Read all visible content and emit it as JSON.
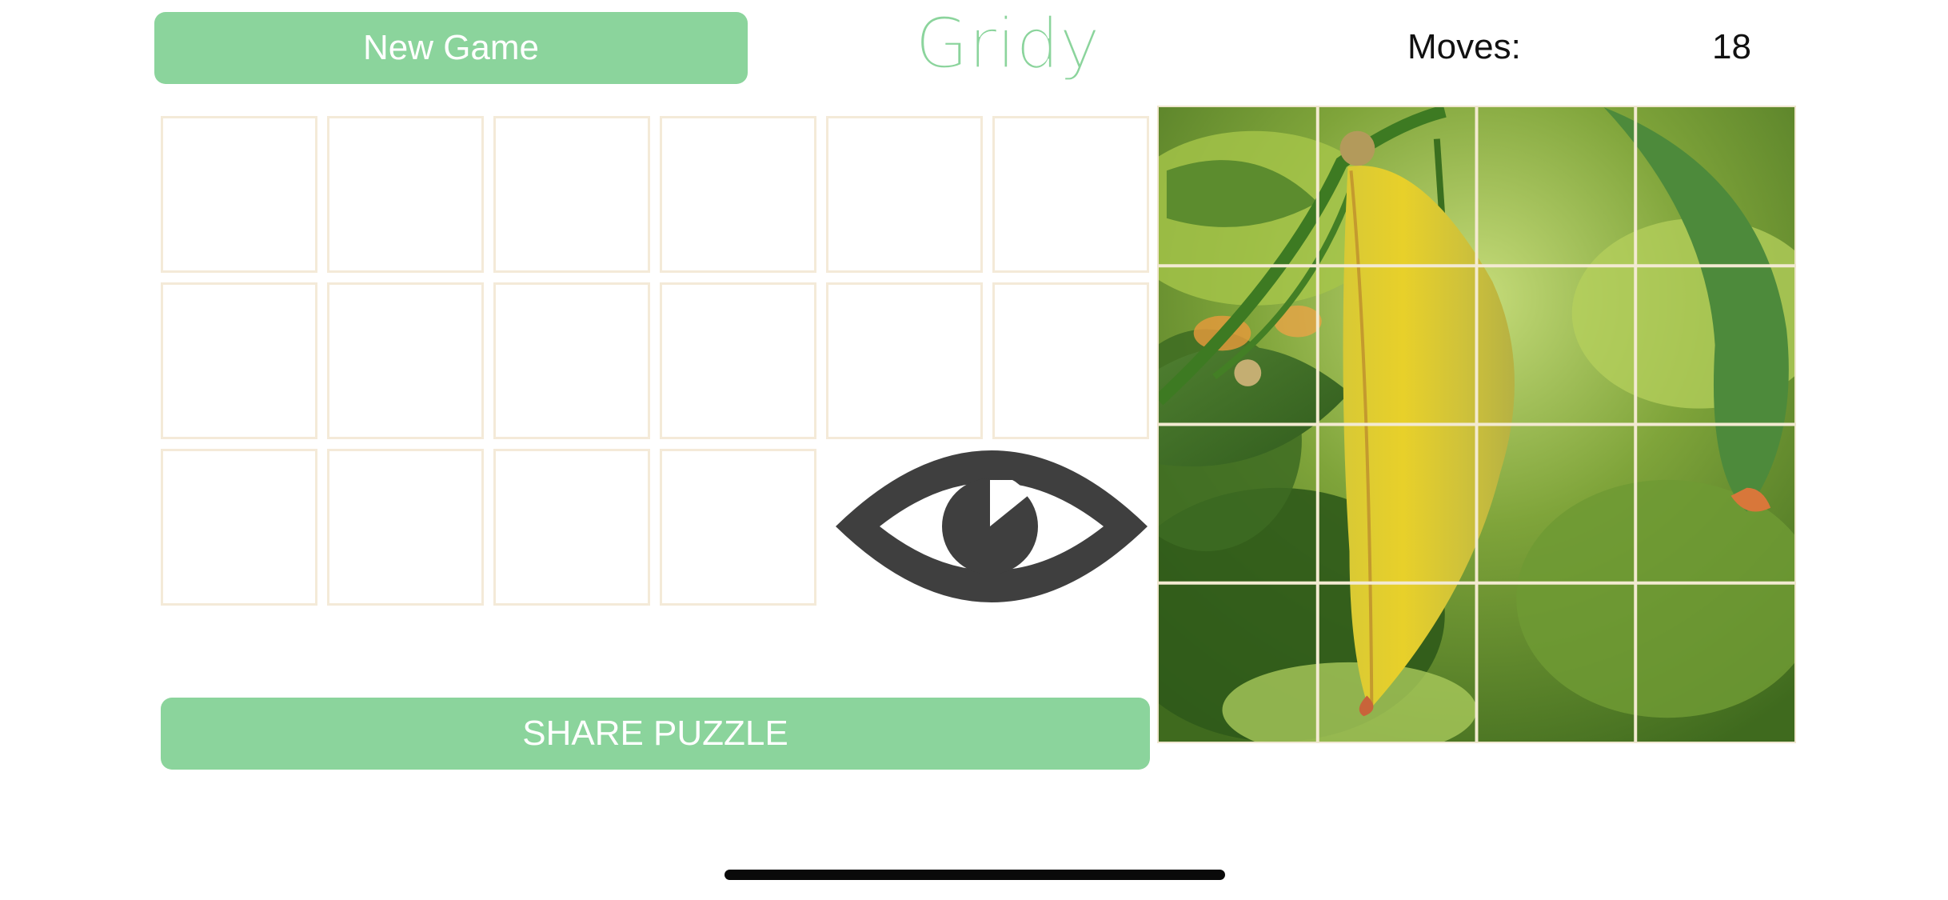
{
  "header": {
    "new_game_label": "New Game",
    "logo_text": "Gridy",
    "moves_label": "Moves:",
    "moves_value": "18"
  },
  "board": {
    "slot_rows": [
      6,
      6,
      4
    ],
    "preview_icon": "eye-icon"
  },
  "puzzle_image": {
    "subject": "yellow leaf on green citrus branch",
    "grid_rows": 4,
    "grid_cols": 4
  },
  "footer": {
    "share_label": "SHARE PUZZLE"
  },
  "colors": {
    "accent": "#8bd49c",
    "slot_border": "#f4ead8",
    "eye": "#3f3f3f",
    "grid_line": "#f3ead2"
  }
}
